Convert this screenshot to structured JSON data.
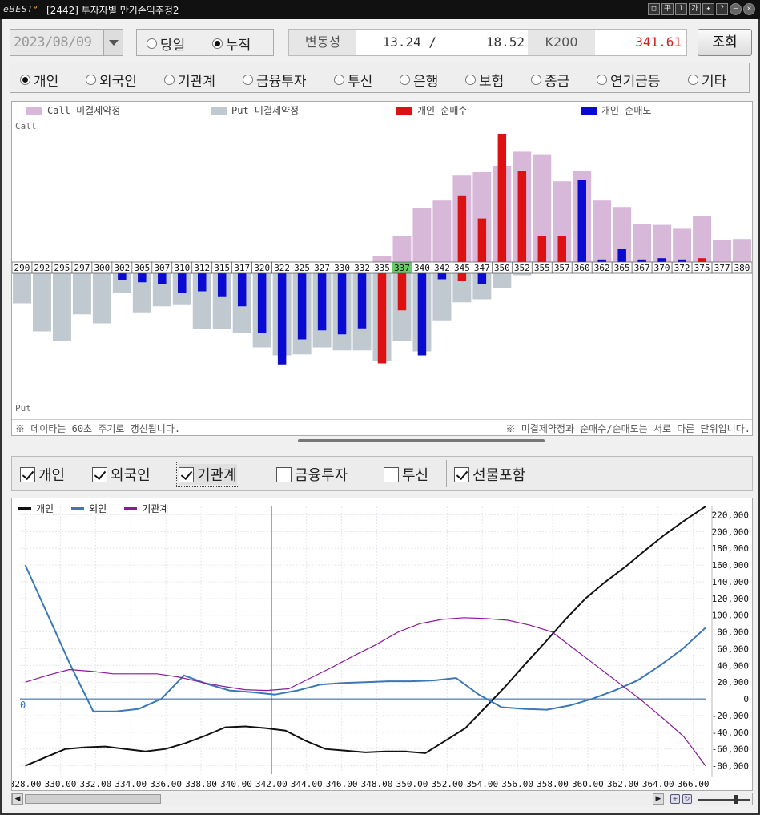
{
  "window": {
    "brand": "BEST",
    "title": "[2442] 투자자별 만기손익추정2",
    "buttons": [
      "□",
      "平",
      "1",
      "가",
      "✦",
      "?",
      "—",
      "✕"
    ]
  },
  "controls": {
    "date": "2023/08/09",
    "mode_options": [
      {
        "label": "당일",
        "selected": false
      },
      {
        "label": "누적",
        "selected": true
      }
    ],
    "volatility_label": "변동성",
    "volatility_value1": "13.24 /",
    "volatility_value2": "18.52",
    "index_label": "K200",
    "index_value": "341.61",
    "index_value_color": "#cc2222",
    "query_button": "조회"
  },
  "investors": [
    {
      "label": "개인",
      "selected": true
    },
    {
      "label": "외국인",
      "selected": false
    },
    {
      "label": "기관계",
      "selected": false
    },
    {
      "label": "금융투자",
      "selected": false
    },
    {
      "label": "투신",
      "selected": false
    },
    {
      "label": "은행",
      "selected": false
    },
    {
      "label": "보험",
      "selected": false
    },
    {
      "label": "종금",
      "selected": false
    },
    {
      "label": "연기금등",
      "selected": false
    },
    {
      "label": "기타",
      "selected": false
    }
  ],
  "bar_panel": {
    "legend": [
      {
        "label": "Call 미결제약정",
        "color": "#d8b8d8"
      },
      {
        "label": "Put 미결제약정",
        "color": "#c0c8d0"
      },
      {
        "label": "개인 순매수",
        "color": "#dd1111"
      },
      {
        "label": "개인 순매도",
        "color": "#0a0ad0"
      }
    ],
    "call_label": "Call",
    "put_label": "Put",
    "highlight_strike": "337",
    "highlight_color": "#66cc66",
    "footnote_left": "※ 데이타는 60초 주기로 갱신됩니다.",
    "footnote_right": "※ 미결제약정과 순매수/순매도는 서로 다른 단위입니다."
  },
  "chart_data": [
    {
      "type": "bar",
      "categories": [
        "290",
        "292",
        "295",
        "297",
        "300",
        "302",
        "305",
        "307",
        "310",
        "312",
        "315",
        "317",
        "320",
        "322",
        "325",
        "327",
        "330",
        "332",
        "335",
        "337",
        "340",
        "342",
        "345",
        "347",
        "350",
        "352",
        "355",
        "357",
        "360",
        "362",
        "365",
        "367",
        "370",
        "372",
        "375",
        "377",
        "380"
      ],
      "series": [
        {
          "name": "Call 미결제약정",
          "values": [
            0,
            0,
            0,
            0,
            0,
            0,
            0,
            0,
            0,
            0,
            0,
            0,
            0,
            0,
            0,
            0,
            0,
            0,
            5,
            20,
            42,
            48,
            68,
            70,
            75,
            86,
            84,
            63,
            71,
            48,
            43,
            30,
            29,
            26,
            36,
            17,
            18
          ]
        },
        {
          "name": "Put 미결제약정",
          "values": [
            -30,
            -58,
            -68,
            -41,
            -50,
            -20,
            -39,
            -33,
            -31,
            -56,
            -56,
            -60,
            -74,
            -82,
            -81,
            -74,
            -77,
            -77,
            -88,
            -68,
            -78,
            -47,
            -29,
            -26,
            -15,
            -2,
            0,
            0,
            0,
            0,
            0,
            0,
            0,
            0,
            0,
            0,
            0
          ]
        },
        {
          "name": "개인 순매수",
          "values": [
            0,
            0,
            0,
            0,
            0,
            0,
            0,
            0,
            0,
            0,
            0,
            0,
            0,
            0,
            0,
            0,
            0,
            0,
            0,
            0,
            0,
            0,
            52,
            34,
            100,
            71,
            20,
            20,
            0,
            0,
            0,
            0,
            0,
            0,
            3,
            0,
            0
          ]
        },
        {
          "name": "개인 순매도",
          "values": [
            0,
            0,
            0,
            0,
            0,
            -7,
            -9,
            -11,
            -20,
            -18,
            -23,
            -33,
            -60,
            -91,
            -66,
            -57,
            -61,
            -55,
            -90,
            -37,
            -82,
            -6,
            -8,
            -11,
            0,
            0,
            0,
            0,
            64,
            2,
            10,
            2,
            3,
            2,
            0,
            0,
            0
          ]
        }
      ]
    },
    {
      "type": "line",
      "x": [
        328,
        329,
        330,
        331,
        332,
        333,
        334,
        335,
        336,
        337,
        338,
        339,
        340,
        341,
        342,
        343,
        344,
        345,
        346,
        347,
        348,
        349,
        350,
        351,
        352,
        353,
        354,
        355,
        356,
        357,
        358,
        359,
        360,
        361,
        362,
        363,
        364,
        365,
        366
      ],
      "series": [
        {
          "name": "개인",
          "color": "#111111",
          "values": [
            -80000,
            -70000,
            -60000,
            -58000,
            -57000,
            -60000,
            -63000,
            -60000,
            -53000,
            -44000,
            -34000,
            -33000,
            -35000,
            -38000,
            -50000,
            -60000,
            -62000,
            -64000,
            -63000,
            -63000,
            -65000,
            -50000,
            -35000,
            -10000,
            15000,
            42000,
            68000,
            95000,
            120000,
            140000,
            158000,
            178000,
            197000,
            214000,
            230000
          ]
        },
        {
          "name": "외인",
          "color": "#3a78b8",
          "values": [
            160000,
            100000,
            40000,
            -15000,
            -15000,
            -12000,
            0,
            28000,
            18000,
            10000,
            8000,
            5000,
            10000,
            17000,
            19000,
            20000,
            21000,
            21000,
            22000,
            25000,
            5000,
            -10000,
            -12000,
            -13000,
            -8000,
            0,
            10000,
            22000,
            40000,
            60000,
            85000
          ]
        },
        {
          "name": "기관계",
          "color": "#8a1a9a",
          "values": [
            20000,
            28000,
            35000,
            33000,
            30000,
            30000,
            30000,
            26000,
            20000,
            15000,
            11000,
            10000,
            12000,
            25000,
            38000,
            52000,
            65000,
            80000,
            90000,
            95000,
            97000,
            96000,
            94000,
            88000,
            80000,
            60000,
            40000,
            20000,
            0,
            -22000,
            -45000,
            -80000
          ]
        }
      ],
      "x_ticks": [
        "328.00",
        "330.00",
        "332.00",
        "334.00",
        "336.00",
        "338.00",
        "340.00",
        "342.00",
        "344.00",
        "346.00",
        "348.00",
        "350.00",
        "352.00",
        "354.00",
        "356.00",
        "358.00",
        "360.00",
        "362.00",
        "364.00",
        "366.00"
      ],
      "y_ticks": [
        "220,000",
        "200,000",
        "180,000",
        "160,000",
        "140,000",
        "120,000",
        "100,000",
        "80,000",
        "60,000",
        "40,000",
        "20,000",
        "0",
        "-20,000",
        "-40,000",
        "-60,000",
        "-80,000"
      ],
      "ylim": [
        -90000,
        230000
      ],
      "zero_label": "0",
      "crosshair_x": 342
    }
  ],
  "filters": [
    {
      "label": "개인",
      "checked": true
    },
    {
      "label": "외국인",
      "checked": true
    },
    {
      "label": "기관계",
      "checked": true
    },
    {
      "label": "금융투자",
      "checked": false
    },
    {
      "label": "투신",
      "checked": false
    },
    {
      "label": "선물포함",
      "checked": true
    }
  ],
  "scroll": {
    "left_arrow": "◀",
    "right_arrow": "▶"
  }
}
